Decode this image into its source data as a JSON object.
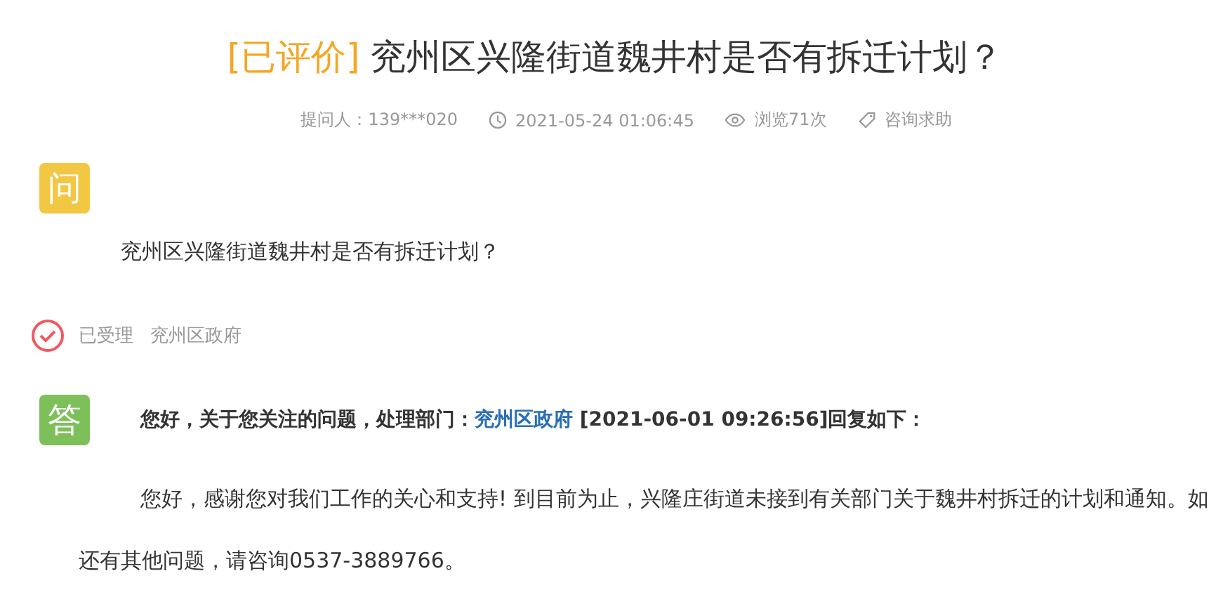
{
  "title": {
    "tag": "[已评价]",
    "text": "兖州区兴隆街道魏井村是否有拆迁计划？"
  },
  "meta": [
    {
      "kind": "asker",
      "text": "提问人：139***020"
    },
    {
      "kind": "time",
      "text": "2021-05-24 01:06:45"
    },
    {
      "kind": "views",
      "text": "浏览71次"
    },
    {
      "kind": "category",
      "text": "咨询求助"
    }
  ],
  "question": {
    "badge": "问",
    "text": "兖州区兴隆街道魏井村是否有拆迁计划？"
  },
  "status": {
    "label": "已受理",
    "department": "兖州区政府"
  },
  "answer": {
    "badge": "答",
    "header_prefix": "您好，关于您关注的问题，处理部门：",
    "department": "兖州区政府",
    "header_suffix": "[2021-06-01 09:26:56]回复如下：",
    "body": "您好，感谢您对我们工作的关心和支持! 到目前为止，兴隆庄街道未接到有关部门关于魏井村拆迁的计划和通知。如还有其他问题，请咨询0537-3889766。"
  }
}
